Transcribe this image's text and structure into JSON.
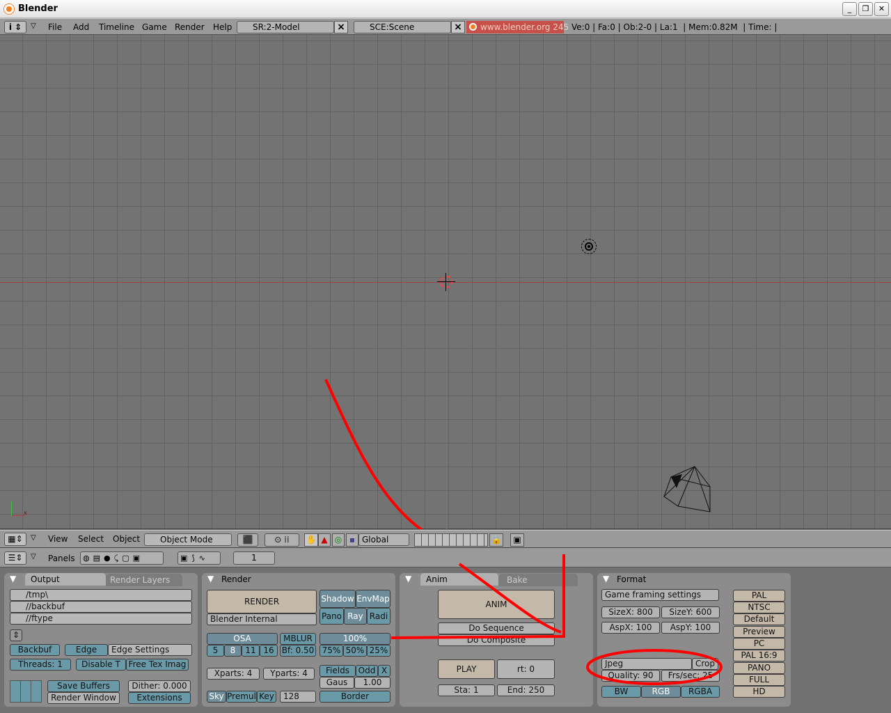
{
  "window": {
    "title": "Blender"
  },
  "menu": {
    "items": [
      "File",
      "Add",
      "Timeline",
      "Game",
      "Render",
      "Help"
    ]
  },
  "screen_field": "SR:2-Model",
  "scene_field": "SCE:Scene",
  "blender_link": "www.blender.org 245",
  "stats": "Ve:0 | Fa:0 | Ob:2-0 | La:1  | Mem:0.82M  | Time: |",
  "view3d_header": {
    "menus": [
      "View",
      "Select",
      "Object"
    ],
    "mode": "Object Mode",
    "orientation": "Global"
  },
  "buttons_header": {
    "panels_label": "Panels",
    "frame": "1"
  },
  "output": {
    "tabs": [
      "Output",
      "Render Layers"
    ],
    "paths": [
      "/tmp\\",
      "//backbuf",
      "//ftype"
    ],
    "backbuf": "Backbuf",
    "edge": "Edge",
    "edge_settings": "Edge Settings",
    "threads": "Threads: 1",
    "disable_t": "Disable T",
    "free_tex": "Free Tex Imag",
    "save_buffers": "Save Buffers",
    "render_window": "Render Window",
    "dither": "Dither: 0.000",
    "extensions": "Extensions"
  },
  "render": {
    "title": "Render",
    "render_btn": "RENDER",
    "engine": "Blender Internal",
    "shadow": "Shadow",
    "envmap": "EnvMap",
    "pano": "Pano",
    "ray": "Ray",
    "radi": "Radi",
    "osa": "OSA",
    "osa_levels": [
      "5",
      "8",
      "11",
      "16"
    ],
    "mblur": "MBLUR",
    "bf": "Bf: 0.50",
    "size_pct": "100%",
    "sizes": [
      "75%",
      "50%",
      "25%"
    ],
    "xparts": "Xparts: 4",
    "yparts": "Yparts: 4",
    "fields": "Fields",
    "odd": "Odd",
    "x": "X",
    "gauss": "Gaus",
    "filter": "1.00",
    "sky": "Sky",
    "premul": "Premul",
    "key": "Key",
    "bits": "128",
    "border": "Border"
  },
  "anim": {
    "tabs": [
      "Anim",
      "Bake"
    ],
    "anim_btn": "ANIM",
    "do_sequence": "Do Sequence",
    "do_composite": "Do Composite",
    "play": "PLAY",
    "rt": "rt: 0",
    "sta": "Sta: 1",
    "end": "End: 250"
  },
  "format": {
    "title": "Format",
    "game_framing": "Game framing settings",
    "sizex": "SizeX: 800",
    "sizey": "SizeY: 600",
    "aspx": "AspX: 100",
    "aspy": "AspY: 100",
    "filetype": "Jpeg",
    "crop": "Crop",
    "quality": "Quality: 90",
    "frs": "Frs/sec: 25",
    "bw": "BW",
    "rgb": "RGB",
    "rgba": "RGBA",
    "presets": [
      "PAL",
      "NTSC",
      "Default",
      "Preview",
      "PC",
      "PAL 16:9",
      "PANO",
      "FULL",
      "HD"
    ]
  },
  "colors": {
    "annotation": "#ff0000",
    "viewport_bg": "#737373"
  }
}
